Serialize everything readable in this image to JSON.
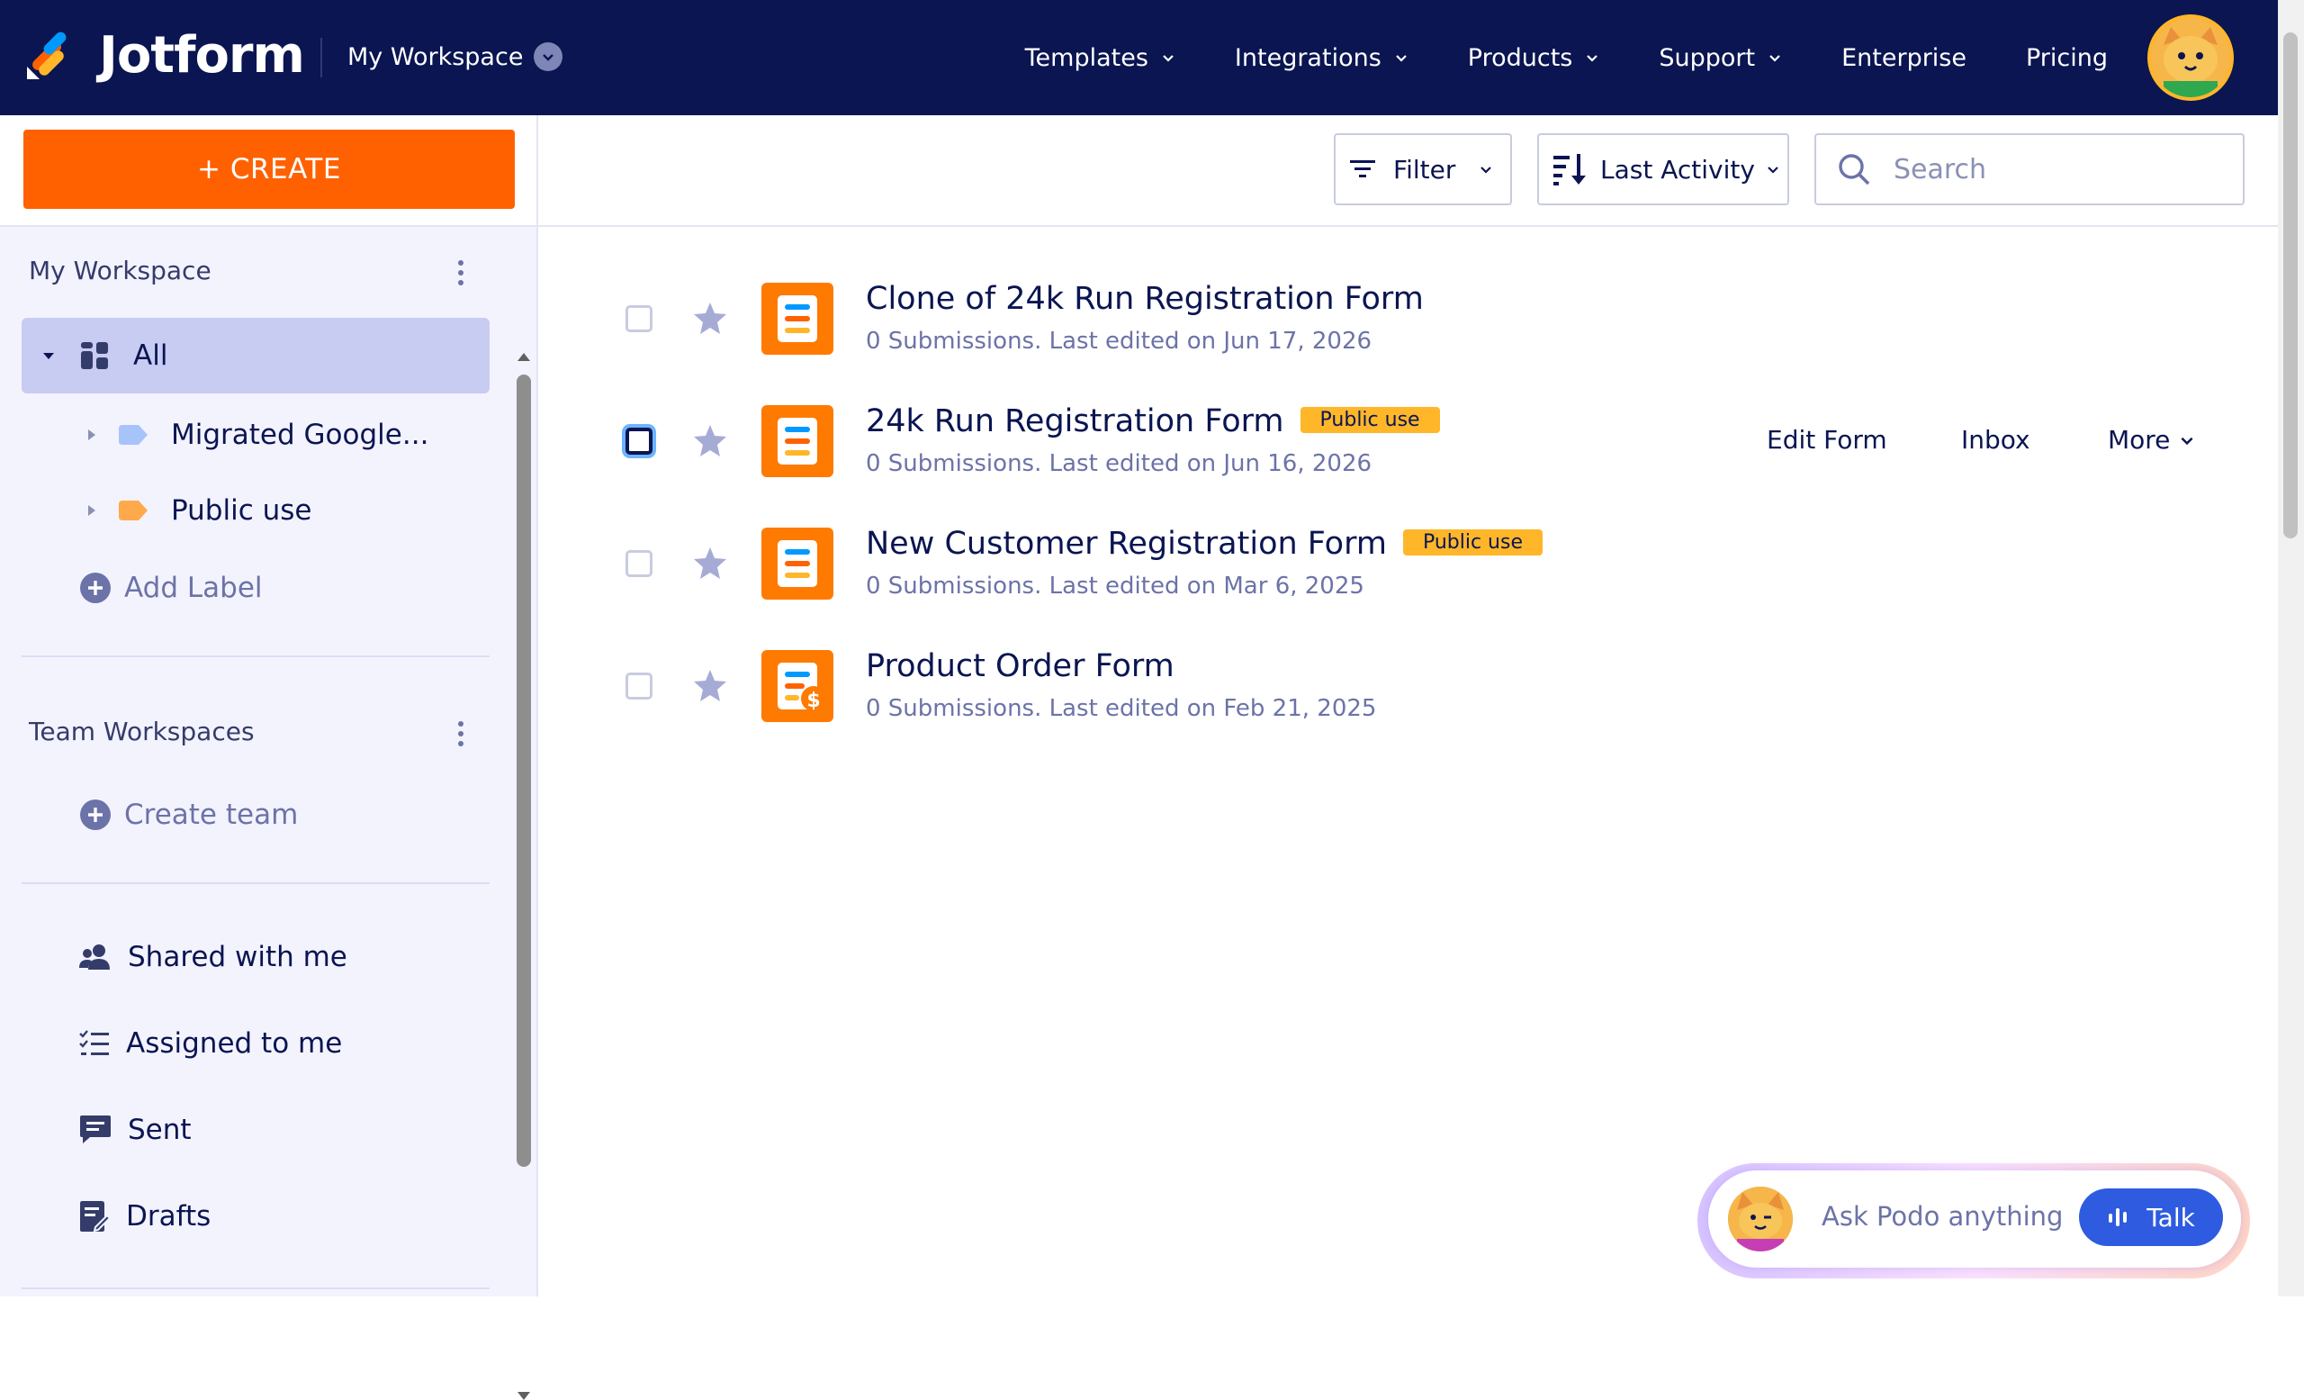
{
  "app": {
    "brand": "Jotform",
    "workspace_switch": "My Workspace"
  },
  "nav": {
    "items": [
      {
        "label": "Templates",
        "has_dropdown": true
      },
      {
        "label": "Integrations",
        "has_dropdown": true
      },
      {
        "label": "Products",
        "has_dropdown": true
      },
      {
        "label": "Support",
        "has_dropdown": true
      },
      {
        "label": "Enterprise",
        "has_dropdown": false
      },
      {
        "label": "Pricing",
        "has_dropdown": false
      }
    ]
  },
  "sidebar": {
    "create_label": "+ CREATE",
    "my_workspace_title": "My Workspace",
    "all_label": "All",
    "labels": [
      {
        "label": "Migrated Google...",
        "color": "#a7c4fa"
      },
      {
        "label": "Public use",
        "color": "#ffa94d"
      }
    ],
    "add_label": "Add Label",
    "team_title": "Team Workspaces",
    "create_team": "Create team",
    "links": [
      {
        "label": "Shared with me",
        "icon": "people-icon"
      },
      {
        "label": "Assigned to me",
        "icon": "checklist-icon"
      },
      {
        "label": "Sent",
        "icon": "chat-icon"
      },
      {
        "label": "Drafts",
        "icon": "draft-icon"
      }
    ]
  },
  "toolbar": {
    "filter_label": "Filter",
    "sort_label": "Last Activity",
    "search_placeholder": "Search"
  },
  "forms": [
    {
      "title": "Clone of 24k Run Registration Form",
      "badge": "",
      "meta": "0 Submissions. Last edited on Jun 17, 2026",
      "icon": "form-icon"
    },
    {
      "title": "24k Run Registration Form",
      "badge": "Public use",
      "meta": "0 Submissions. Last edited on Jun 16, 2026",
      "icon": "form-icon"
    },
    {
      "title": "New Customer Registration Form",
      "badge": "Public use",
      "meta": "0 Submissions. Last edited on Mar 6, 2025",
      "icon": "form-icon"
    },
    {
      "title": "Product Order Form",
      "badge": "",
      "meta": "0 Submissions. Last edited on Feb 21, 2025",
      "icon": "payment-form-icon"
    }
  ],
  "row_actions": {
    "edit": "Edit Form",
    "inbox": "Inbox",
    "more": "More"
  },
  "podo": {
    "prompt": "Ask Podo anything",
    "talk_label": "Talk"
  },
  "colors": {
    "navy": "#0a1551",
    "create_orange": "#ff6100",
    "badge_amber": "#ffb629",
    "sidebar_bg": "#f3f3fe",
    "selected_bg": "#c8ccf2",
    "talk_blue": "#2e5be0"
  }
}
